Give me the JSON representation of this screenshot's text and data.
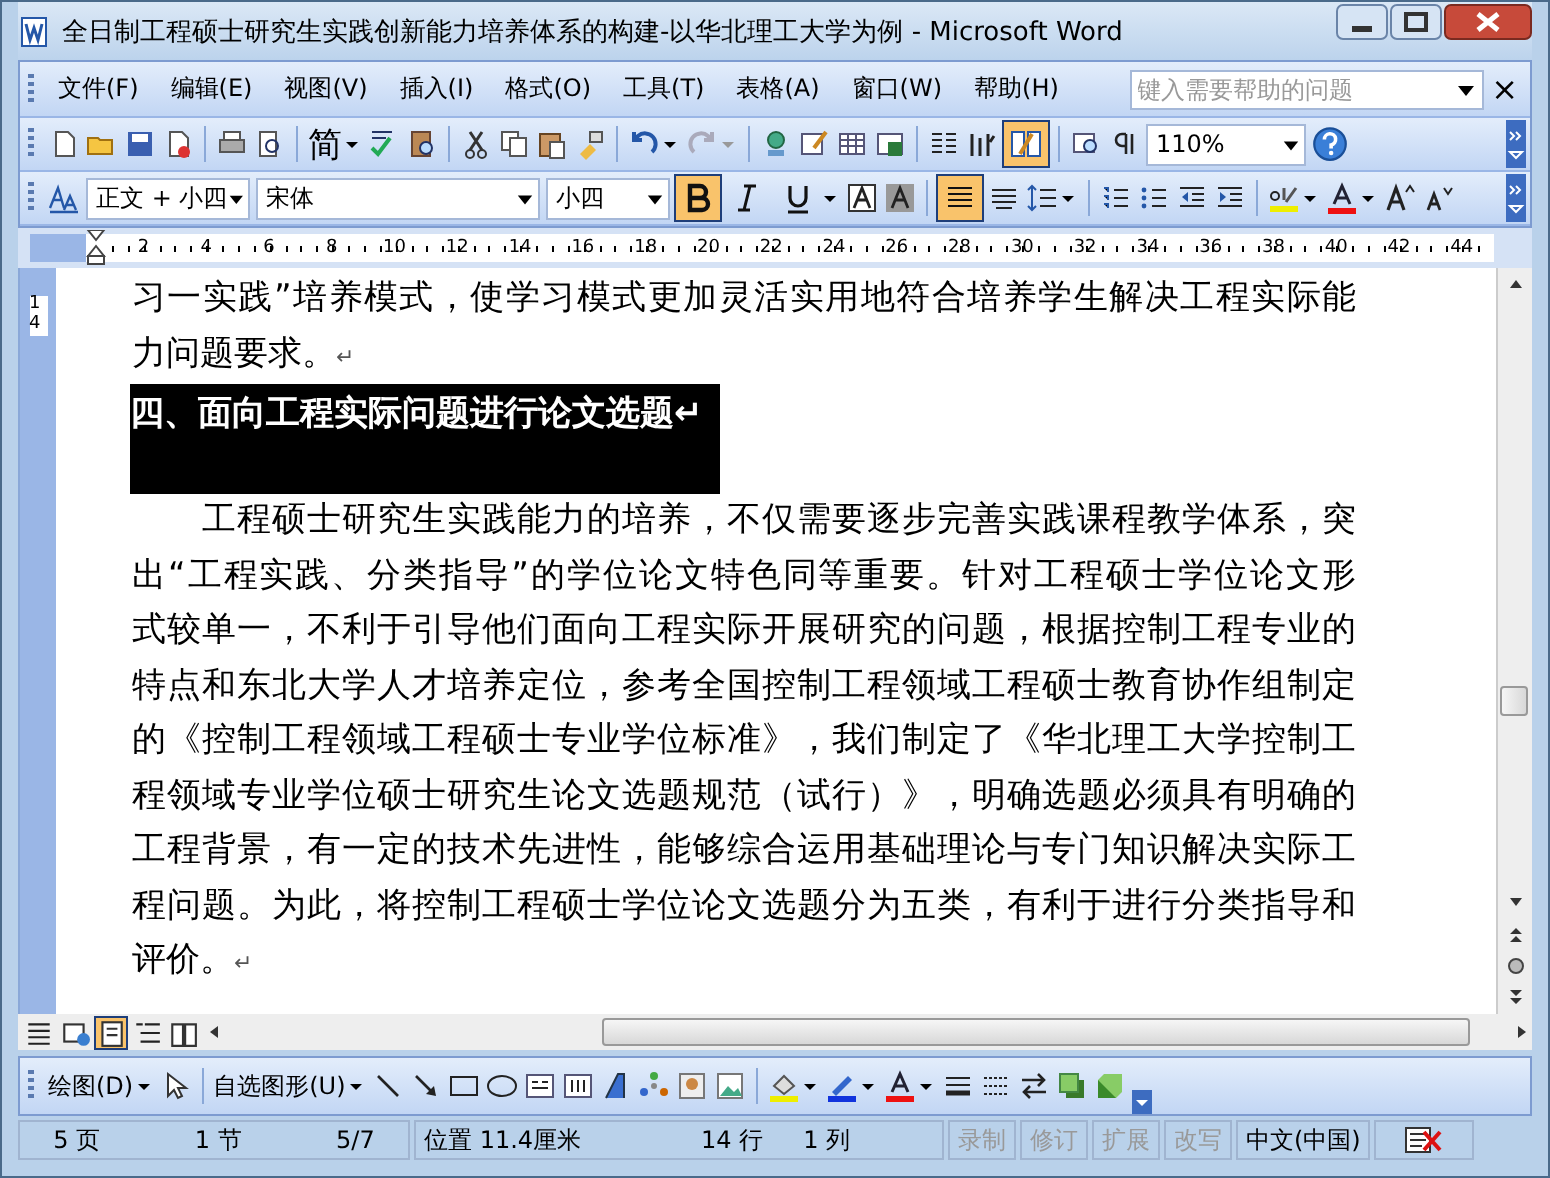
{
  "window": {
    "title": "全日制工程硕士研究生实践创新能力培养体系的构建-以华北理工大学为例 - Microsoft Word"
  },
  "menu": {
    "items": [
      {
        "label": "文件(F)"
      },
      {
        "label": "编辑(E)"
      },
      {
        "label": "视图(V)"
      },
      {
        "label": "插入(I)"
      },
      {
        "label": "格式(O)"
      },
      {
        "label": "工具(T)"
      },
      {
        "label": "表格(A)"
      },
      {
        "label": "窗口(W)"
      },
      {
        "label": "帮助(H)"
      }
    ],
    "help_box": {
      "placeholder": "键入需要帮助的问题"
    },
    "close_glyph": "×"
  },
  "standard_toolbar": {
    "simplified_label": "简",
    "reading_layout_pressed": true,
    "zoom": "110%"
  },
  "formatting_toolbar": {
    "style": "正文 + 小四",
    "font": "宋体",
    "size": "小四",
    "bold": true,
    "italic": false,
    "underline": false,
    "justify": true
  },
  "ruler": {
    "labels": [
      "2",
      "4",
      "6",
      "8",
      "10",
      "12",
      "14",
      "16",
      "18",
      "20",
      "22",
      "24",
      "26",
      "28",
      "30",
      "32",
      "34",
      "36",
      "38",
      "40",
      "42",
      "44"
    ],
    "vertical_label": "14"
  },
  "document": {
    "blocks": [
      {
        "kind": "para",
        "lines": [
          "习一实践”培养模式，使学习模式更加灵活实用地符合培养学生解决工程实际能",
          "力问题要求。"
        ],
        "mark": "↵"
      },
      {
        "kind": "heading",
        "selected": true,
        "lines": [
          "四、面向工程实际问题进行论文选题"
        ],
        "mark": "↵"
      },
      {
        "kind": "para",
        "lines": [
          "　　工程硕士研究生实践能力的培养，不仅需要逐步完善实践课程教学体系，突",
          "出“工程实践、分类指导”的学位论文特色同等重要。针对工程硕士学位论文形",
          "式较单一，不利于引导他们面向工程实际开展研究的问题，根据控制工程专业的",
          "特点和东北大学人才培养定位，参考全国控制工程领域工程硕士教育协作组制定",
          "的《控制工程领域工程硕士专业学位标准》，我们制定了《华北理工大学控制工",
          "程领域专业学位硕士研究生论文选题规范（试行）》，明确选题必须具有明确的",
          "工程背景，有一定的技术先进性，能够综合运用基础理论与专门知识解决实际工",
          "程问题。为此，将控制工程硕士学位论文选题分为五类，有利于进行分类指导和",
          "评价。"
        ],
        "mark": "↵"
      }
    ]
  },
  "views": [
    {
      "selected": false
    },
    {
      "selected": false
    },
    {
      "selected": true
    },
    {
      "selected": false
    },
    {
      "selected": false
    }
  ],
  "drawing_toolbar": {
    "draw_menu": "绘图(D)",
    "autoshapes_menu": "自选图形(U)"
  },
  "status_bar": {
    "page": "5 页",
    "section": "1 节",
    "pages": "5/7",
    "position": "位置 11.4厘米",
    "line": "14 行",
    "column": "1 列",
    "modes": [
      {
        "label": "录制",
        "on": false
      },
      {
        "label": "修订",
        "on": false
      },
      {
        "label": "扩展",
        "on": false
      },
      {
        "label": "改写",
        "on": false
      }
    ],
    "language": "中文(中国)"
  }
}
